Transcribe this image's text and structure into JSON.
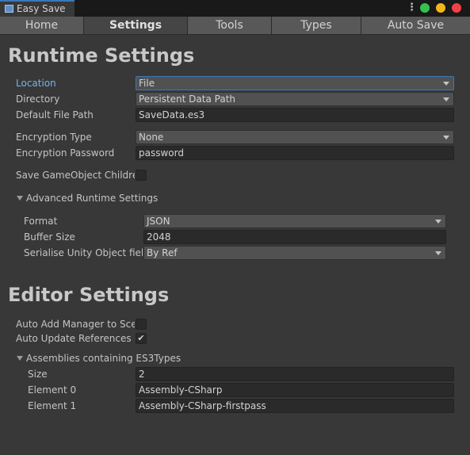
{
  "window": {
    "title": "Easy Save",
    "menu_glyph": "⋮"
  },
  "tabs": [
    "Home",
    "Settings",
    "Tools",
    "Types",
    "Auto Save"
  ],
  "runtime": {
    "heading": "Runtime Settings",
    "location": {
      "label": "Location",
      "value": "File"
    },
    "directory": {
      "label": "Directory",
      "value": "Persistent Data Path"
    },
    "default_file_path": {
      "label": "Default File Path",
      "value": "SaveData.es3"
    },
    "encryption_type": {
      "label": "Encryption Type",
      "value": "None"
    },
    "encryption_password": {
      "label": "Encryption Password",
      "value": "password"
    },
    "save_children": {
      "label": "Save GameObject Children",
      "checked": false
    },
    "advanced": {
      "label": "Advanced Runtime Settings",
      "format": {
        "label": "Format",
        "value": "JSON"
      },
      "buffer_size": {
        "label": "Buffer Size",
        "value": "2048"
      },
      "serialise_unity": {
        "label": "Serialise Unity Object fields",
        "value": "By Ref"
      }
    }
  },
  "editor": {
    "heading": "Editor Settings",
    "auto_add_manager": {
      "label": "Auto Add Manager to Scene",
      "checked": false
    },
    "auto_update_refs": {
      "label": "Auto Update References",
      "checked": true,
      "check_glyph": "✔"
    },
    "assemblies": {
      "label": "Assemblies containing ES3Types",
      "size": {
        "label": "Size",
        "value": "2"
      },
      "element0": {
        "label": "Element 0",
        "value": "Assembly-CSharp"
      },
      "element1": {
        "label": "Element 1",
        "value": "Assembly-CSharp-firstpass"
      }
    }
  },
  "colors": {
    "background": "#383838",
    "accent": "#3a79bb",
    "focus_label": "#7ab1ec",
    "close": "#ef4146",
    "minimize": "#f4b61a",
    "maximize": "#32c24d"
  }
}
